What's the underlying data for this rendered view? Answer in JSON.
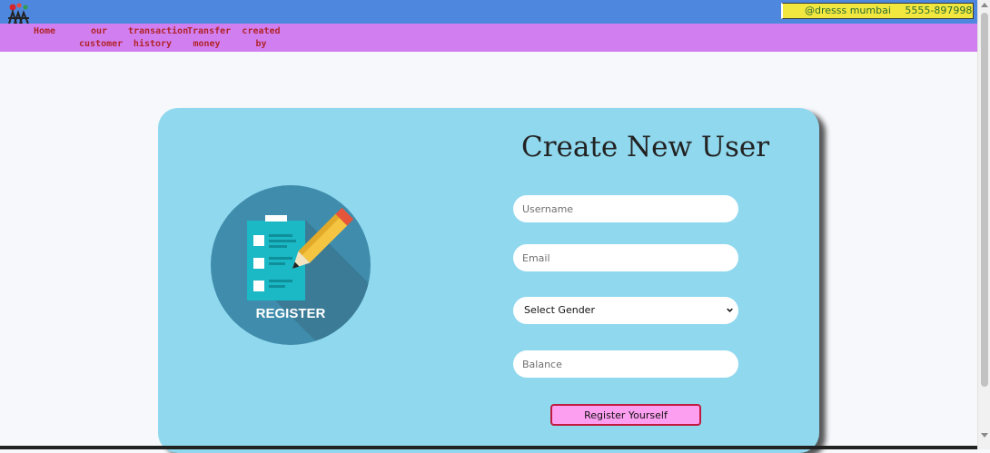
{
  "header": {
    "address": "@dresss mumbai",
    "phone": "5555-897998"
  },
  "nav": {
    "items": [
      {
        "line1": "Home",
        "line2": ""
      },
      {
        "line1": "our",
        "line2": "customer"
      },
      {
        "line1": "transaction",
        "line2": "history"
      },
      {
        "line1": "Transfer",
        "line2": "money"
      },
      {
        "line1": "created by",
        "line2": ""
      }
    ]
  },
  "illustration": {
    "label": "REGISTER"
  },
  "form": {
    "title": "Create New User",
    "username_placeholder": "Username",
    "email_placeholder": "Email",
    "gender_selected": "Select Gender",
    "balance_placeholder": "Balance",
    "submit_label": "Register Yourself"
  },
  "colors": {
    "header_bg": "#4e88de",
    "nav_bg": "#d17ff0",
    "nav_text": "#b0242b",
    "card_bg": "#90d8ee",
    "button_bg": "#fc9ff0",
    "button_border": "#c2193f",
    "address_bg": "#f2e73f"
  }
}
